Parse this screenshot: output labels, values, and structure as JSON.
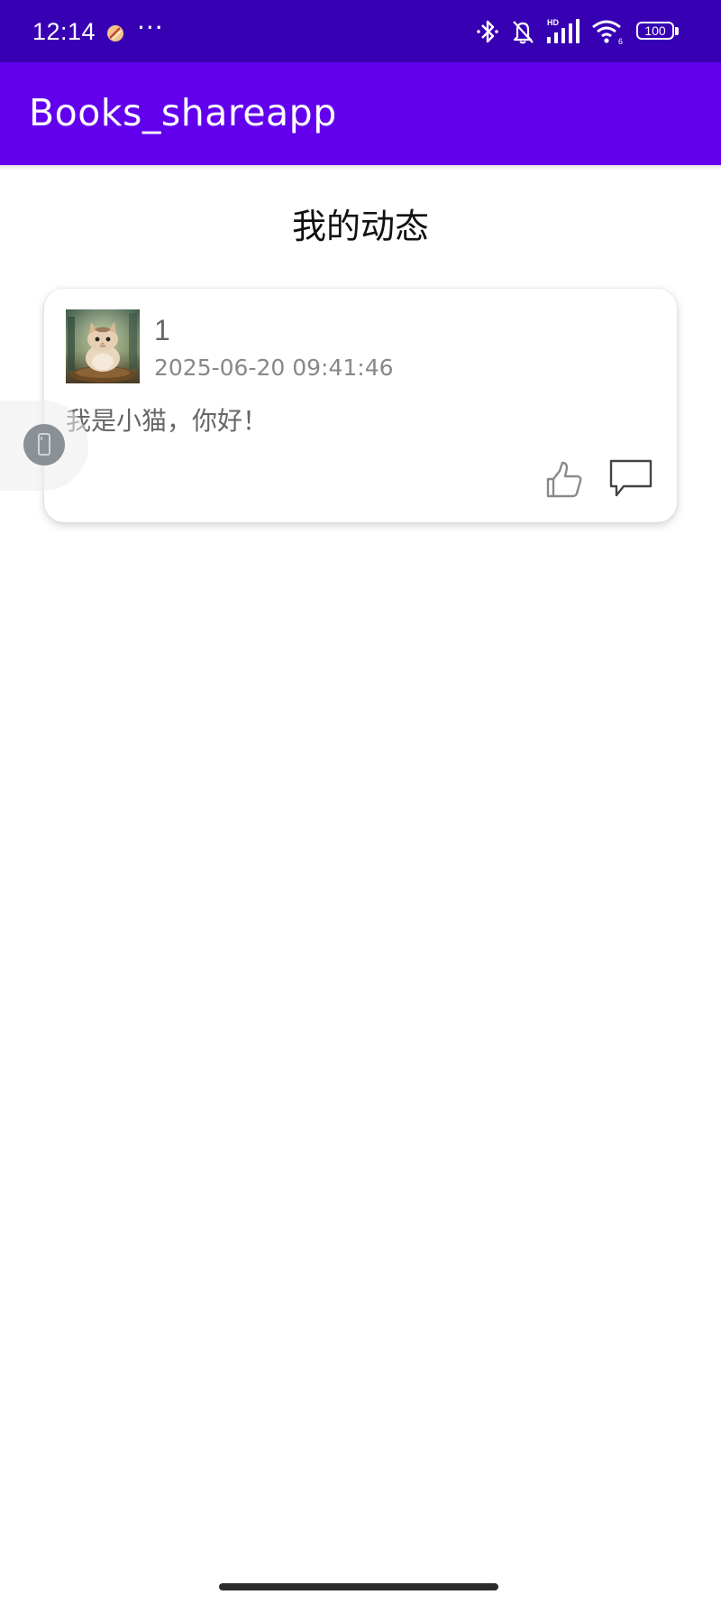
{
  "status_bar": {
    "time": "12:14",
    "overflow_dots": "···",
    "battery_level": "100",
    "signal_hd_label": "HD",
    "wifi_badge": "6",
    "background_color": "#3700B3"
  },
  "app_bar": {
    "title": "Books_shareapp",
    "background_color": "#6200EE"
  },
  "page": {
    "title": "我的动态"
  },
  "posts": [
    {
      "username": "1",
      "timestamp": "2025-06-20 09:41:46",
      "content": "我是小猫，你好！",
      "avatar_icon": "cat-avatar-image",
      "like_icon": "thumbs-up-icon",
      "comment_icon": "comment-bubble-icon"
    }
  ],
  "floating_tool": {
    "icon": "phone-icon"
  }
}
